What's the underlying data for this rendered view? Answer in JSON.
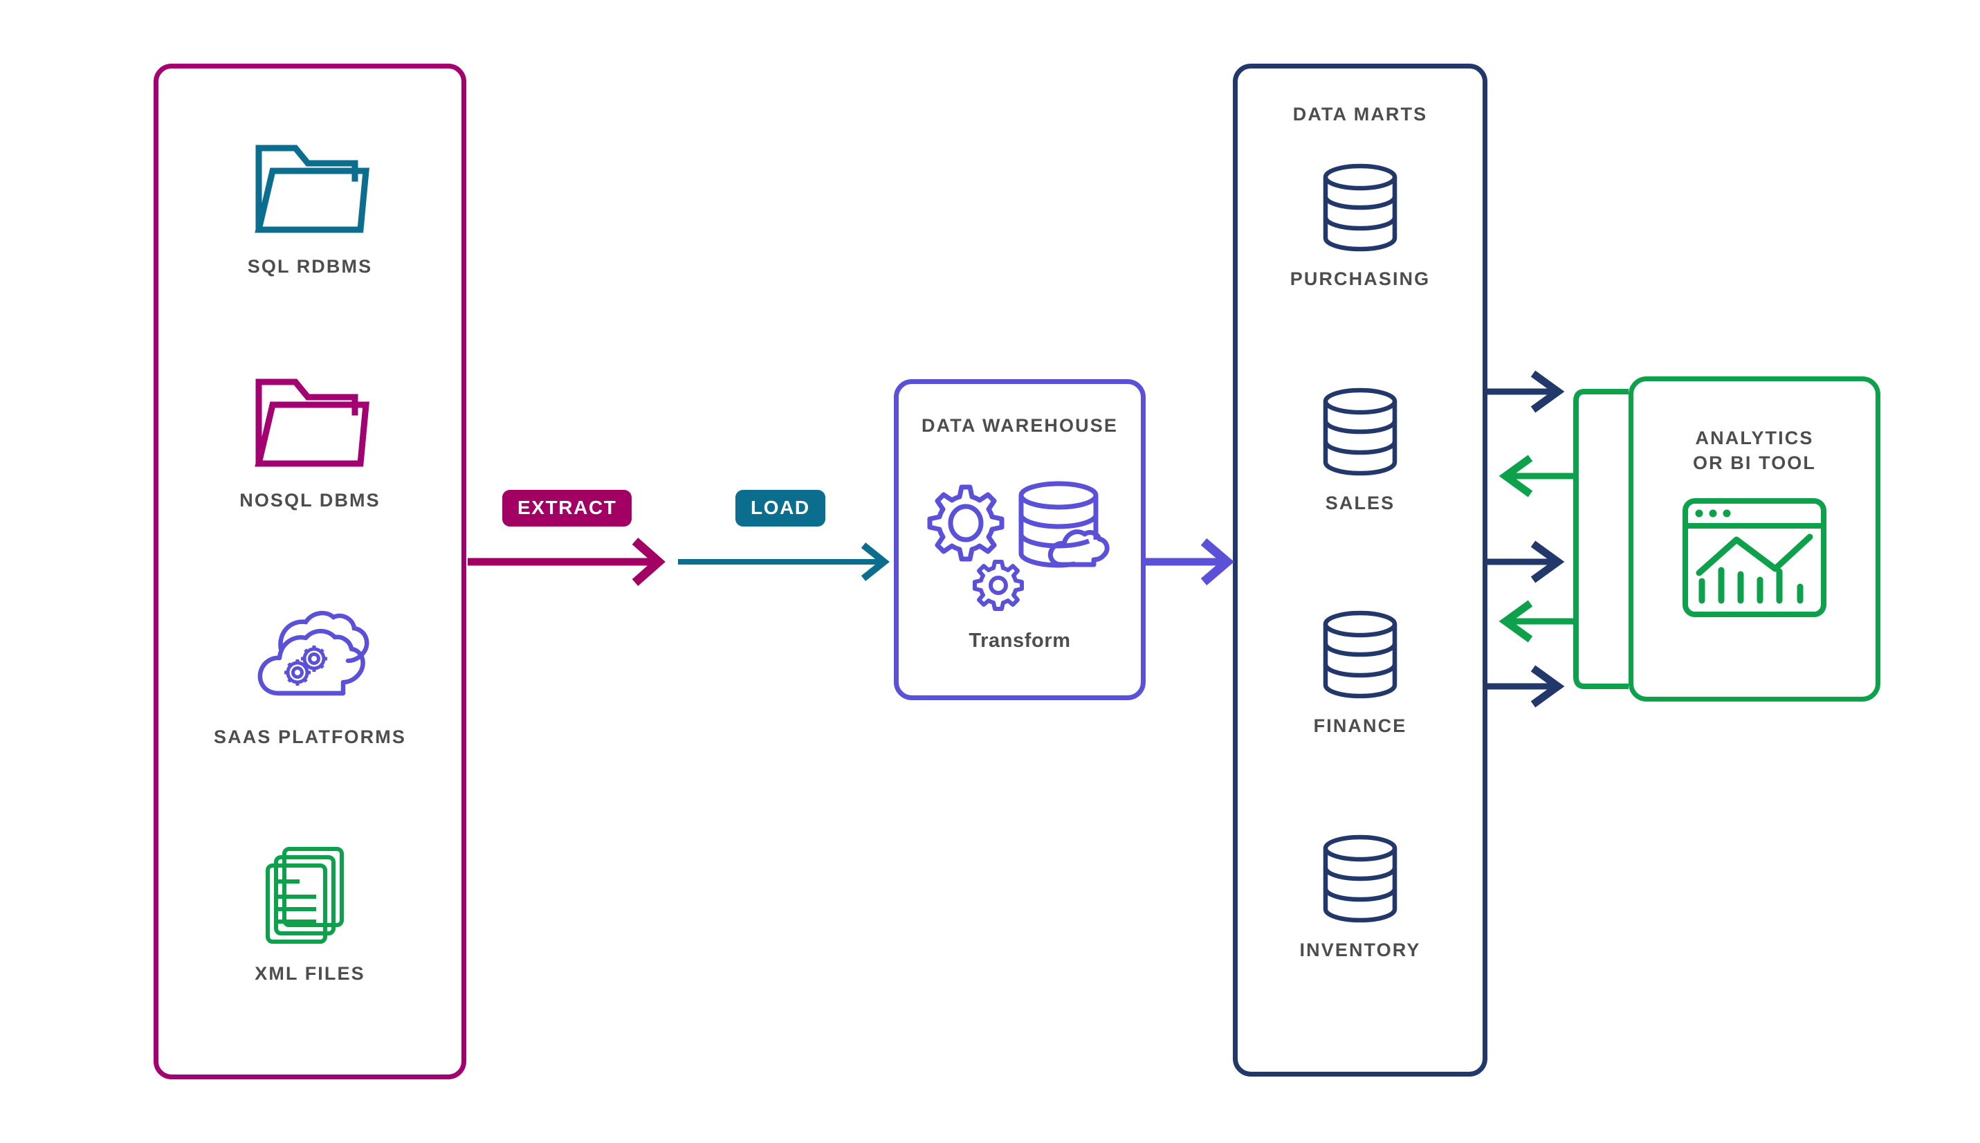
{
  "diagram": {
    "title_hidden": "ETL data pipeline: sources to data warehouse to data marts to BI",
    "background": "transparent"
  },
  "colors": {
    "magenta": "#A30071",
    "crimson": "#B3006B",
    "teal": "#0B6E8F",
    "purple": "#5B51D8",
    "navy": "#22386B",
    "green": "#0DA14B",
    "text_gray": "#4d4d4d"
  },
  "sources": {
    "panel_border_color": "#A30071",
    "items": [
      {
        "label": "SQL RDBMS",
        "icon": "folder-icon",
        "color": "#0B6E8F"
      },
      {
        "label": "NOSQL DBMS",
        "icon": "folder-icon",
        "color": "#A30071"
      },
      {
        "label": "SAAS PLATFORMS",
        "icon": "cloud-gears-icon",
        "color": "#5B51D8"
      },
      {
        "label": "XML FILES",
        "icon": "documents-stack-icon",
        "color": "#0DA14B"
      }
    ]
  },
  "stages": [
    {
      "label": "EXTRACT",
      "bg": "#A30063",
      "text_color": "#ffffff"
    },
    {
      "label": "LOAD",
      "bg": "#0B6E8F",
      "text_color": "#ffffff"
    }
  ],
  "warehouse": {
    "title": "DATA WAREHOUSE",
    "sub_label": "Transform",
    "border_color": "#5B51D8",
    "icons": [
      "gear-large-icon",
      "gear-small-icon",
      "database-cylinder-icon",
      "cloud-icon"
    ]
  },
  "marts": {
    "title": "DATA MARTS",
    "border_color": "#22386B",
    "items": [
      {
        "label": "PURCHASING",
        "icon": "database-cylinder-icon"
      },
      {
        "label": "SALES",
        "icon": "database-cylinder-icon"
      },
      {
        "label": "FINANCE",
        "icon": "database-cylinder-icon"
      },
      {
        "label": "INVENTORY",
        "icon": "database-cylinder-icon"
      }
    ]
  },
  "bi": {
    "title_line1": "ANALYTICS",
    "title_line2": "OR BI TOOL",
    "border_color": "#0DA14B",
    "icon": "chart-window-icon"
  },
  "connectors": [
    {
      "name": "extract-arrow",
      "from": "sources",
      "to": "load-arrow",
      "color": "#A30063",
      "direction": "right"
    },
    {
      "name": "load-arrow",
      "from": "extract-arrow",
      "to": "warehouse",
      "color": "#0B6E8F",
      "direction": "right"
    },
    {
      "name": "warehouse-to-marts-arrow",
      "from": "warehouse",
      "to": "marts",
      "color": "#5B51D8",
      "direction": "right"
    },
    {
      "name": "marts-to-bi-arrow-1",
      "color": "#22386B",
      "direction": "right"
    },
    {
      "name": "bi-to-marts-arrow-1",
      "color": "#0DA14B",
      "direction": "left"
    },
    {
      "name": "marts-to-bi-arrow-2",
      "color": "#22386B",
      "direction": "right"
    },
    {
      "name": "bi-to-marts-arrow-2",
      "color": "#0DA14B",
      "direction": "left"
    },
    {
      "name": "marts-to-bi-arrow-3",
      "color": "#22386B",
      "direction": "right"
    }
  ]
}
